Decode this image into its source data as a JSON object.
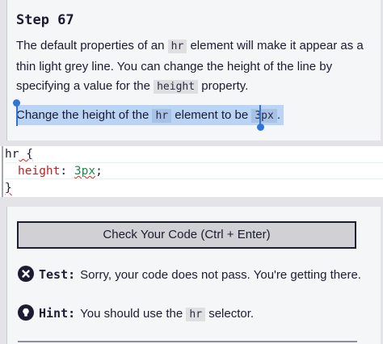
{
  "step": {
    "title": "Step 67"
  },
  "description": {
    "part1": "The default properties of an ",
    "code1": "hr",
    "part2": " element will make it appear as a thin light grey line. You can change the height of the line by specifying a value for the ",
    "code2": "height",
    "part3": " property."
  },
  "task": {
    "part1": "Change the height of the ",
    "code": "hr",
    "part2": " element to be ",
    "value": "3px",
    "part3": "."
  },
  "editor": {
    "line1_selector": "hr",
    "line1_brace": " {",
    "line2_property": "height",
    "line2_colon": ": ",
    "line2_value": "3px",
    "line2_semicolon": ";",
    "line3": "}"
  },
  "check_button": {
    "label": "Check Your Code (Ctrl + Enter)"
  },
  "test": {
    "label": "Test:",
    "message": "Sorry, your code does not pass. You're getting there."
  },
  "hint": {
    "label": "Hint:",
    "part1": "You should use the ",
    "code": "hr",
    "part2": " selector."
  },
  "icons": {
    "test": "close-circle-icon",
    "hint": "lightbulb-icon"
  },
  "colors": {
    "selection": "#b9d4f4",
    "handle": "#2f74d8",
    "property": "#c41e1e",
    "number": "#1d8a4d"
  }
}
